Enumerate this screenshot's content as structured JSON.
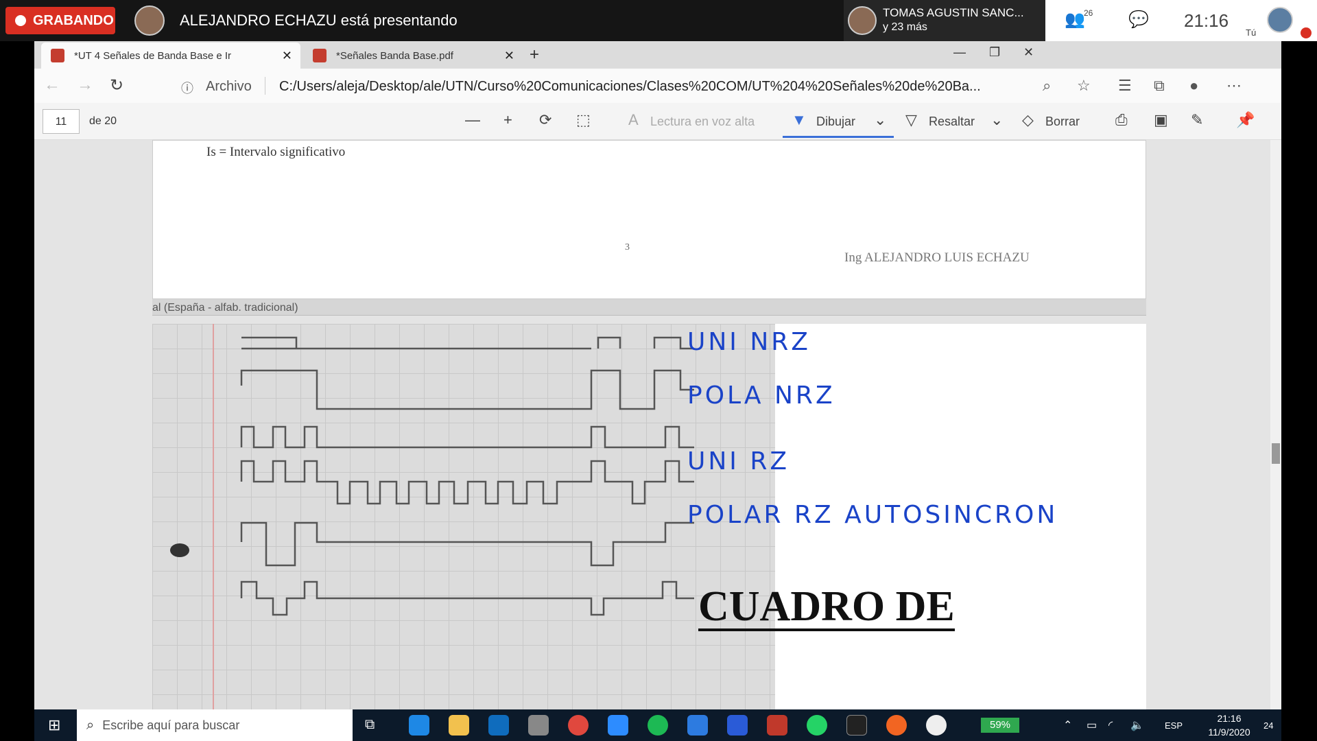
{
  "meeting": {
    "recording_label": "GRABANDO",
    "presenter_text": "ALEJANDRO ECHAZU está presentando",
    "participant_name": "TOMAS AGUSTIN SANC...",
    "participant_more": "y 23 más",
    "people_count": "26",
    "clock": "21:16",
    "self_label": "Tú"
  },
  "browser": {
    "tabs": [
      {
        "label": "*UT 4 Señales de Banda Base e Ir"
      },
      {
        "label": "*Señales Banda Base.pdf"
      }
    ],
    "archivo_label": "Archivo",
    "url": "C:/Users/aleja/Desktop/ale/UTN/Curso%20Comunicaciones/Clases%20COM/UT%204%20Señales%20de%20Ba..."
  },
  "pdf_toolbar": {
    "page_current": "11",
    "page_of": "de 20",
    "read_aloud": "Lectura en voz alta",
    "draw": "Dibujar",
    "highlight": "Resaltar",
    "erase": "Borrar"
  },
  "document": {
    "is_text": "Is = Intervalo significativo",
    "page_number": "3",
    "author": "Ing ALEJANDRO LUIS ECHAZU",
    "strip_text": "al (España - alfab. tradicional)",
    "annotations": [
      "UNI NRZ",
      "POLA NRZ",
      "UNI RZ",
      "POLAR RZ AUTOSINCRON"
    ],
    "heading": "CUADRO DE"
  },
  "taskbar": {
    "search_placeholder": "Escribe aquí para buscar",
    "battery": "59%",
    "language": "ESP",
    "time": "21:16",
    "date": "11/9/2020",
    "notifications": "24"
  },
  "colors": {
    "recording": "#d92f22",
    "ink_blue": "#1a43c8",
    "selected_tool": "#3a6fd8"
  }
}
